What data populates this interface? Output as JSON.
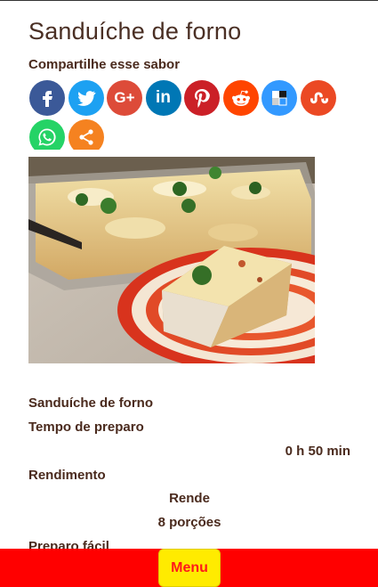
{
  "page": {
    "title": "Sanduíche de forno",
    "share_label": "Compartilhe esse sabor"
  },
  "share_buttons": [
    {
      "network": "Facebook",
      "icon": "facebook-icon",
      "color": "#3b5998"
    },
    {
      "network": "Twitter",
      "icon": "twitter-icon",
      "color": "#1da1f2"
    },
    {
      "network": "Google+",
      "icon": "google-plus-icon",
      "color": "#dd4b39"
    },
    {
      "network": "LinkedIn",
      "icon": "linkedin-icon",
      "color": "#0077b5"
    },
    {
      "network": "Pinterest",
      "icon": "pinterest-icon",
      "color": "#cb2027"
    },
    {
      "network": "Reddit",
      "icon": "reddit-icon",
      "color": "#ff4500"
    },
    {
      "network": "Delicious",
      "icon": "delicious-icon",
      "color": "#3399ff"
    },
    {
      "network": "StumbleUpon",
      "icon": "stumbleupon-icon",
      "color": "#eb4924"
    },
    {
      "network": "WhatsApp",
      "icon": "whatsapp-icon",
      "color": "#25d366"
    },
    {
      "network": "More",
      "icon": "share-icon",
      "color": "#f58220"
    }
  ],
  "recipe": {
    "name": "Sanduíche de forno",
    "prep_label": "Tempo de preparo",
    "prep_value": "0 h 50 min",
    "yield_label": "Rendimento",
    "yield_caption": "Rende",
    "yield_value": "8 porções",
    "difficulty_label": "Preparo fácil"
  },
  "menu": {
    "label": "Menu",
    "bar_color": "#ff0000",
    "button_color": "#ffeb00"
  }
}
